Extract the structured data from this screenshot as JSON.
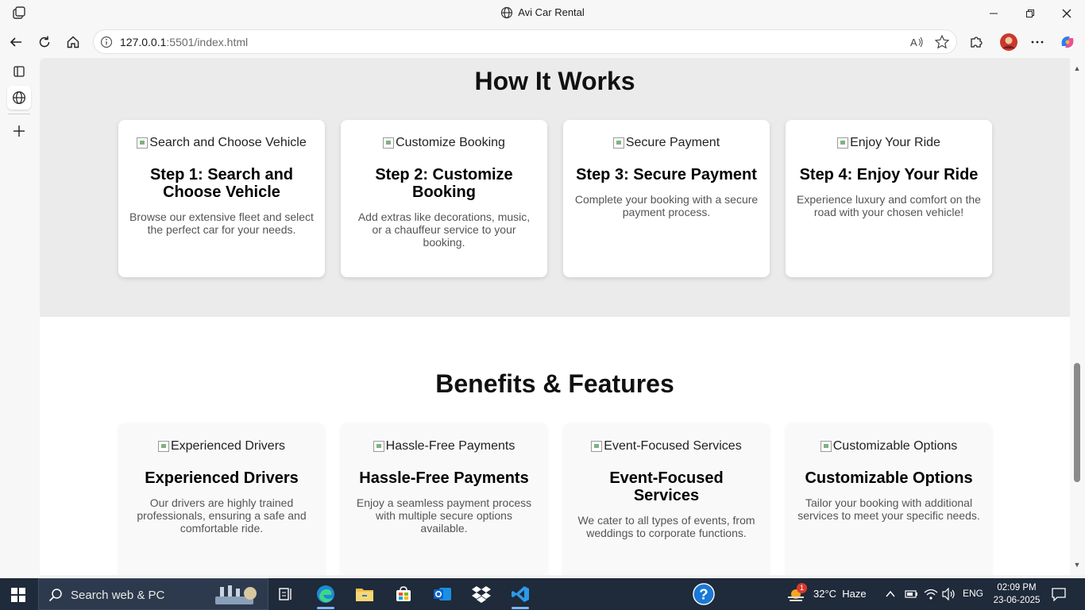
{
  "window": {
    "title": "Avi Car Rental"
  },
  "addressbar": {
    "url_host": "127.0.0.1",
    "url_rest": ":5501/index.html"
  },
  "how_it_works": {
    "heading": "How It Works",
    "steps": [
      {
        "img_alt": "Search and Choose Vehicle",
        "title": "Step 1: Search and Choose Vehicle",
        "desc": "Browse our extensive fleet and select the perfect car for your needs."
      },
      {
        "img_alt": "Customize Booking",
        "title": "Step 2: Customize Booking",
        "desc": "Add extras like decorations, music, or a chauffeur service to your booking."
      },
      {
        "img_alt": "Secure Payment",
        "title": "Step 3: Secure Payment",
        "desc": "Complete your booking with a secure payment process."
      },
      {
        "img_alt": "Enjoy Your Ride",
        "title": "Step 4: Enjoy Your Ride",
        "desc": "Experience luxury and comfort on the road with your chosen vehicle!"
      }
    ]
  },
  "benefits": {
    "heading": "Benefits & Features",
    "items": [
      {
        "img_alt": "Experienced Drivers",
        "title": "Experienced Drivers",
        "desc": "Our drivers are highly trained professionals, ensuring a safe and comfortable ride."
      },
      {
        "img_alt": "Hassle-Free Payments",
        "title": "Hassle-Free Payments",
        "desc": "Enjoy a seamless payment process with multiple secure options available."
      },
      {
        "img_alt": "Event-Focused Services",
        "title": "Event-Focused Services",
        "desc": "We cater to all types of events, from weddings to corporate functions."
      },
      {
        "img_alt": "Customizable Options",
        "title": "Customizable Options",
        "desc": "Tailor your booking with additional services to meet your specific needs."
      }
    ]
  },
  "taskbar": {
    "search_placeholder": "Search web & PC",
    "weather_badge": "1",
    "weather": "32°C  Haze",
    "language": "ENG",
    "time": "02:09 PM",
    "date": "23-06-2025"
  },
  "colors": {
    "accent_blue": "#0078d4",
    "taskbar_bg": "#1f2a3a",
    "grey_section": "#ebebeb"
  }
}
